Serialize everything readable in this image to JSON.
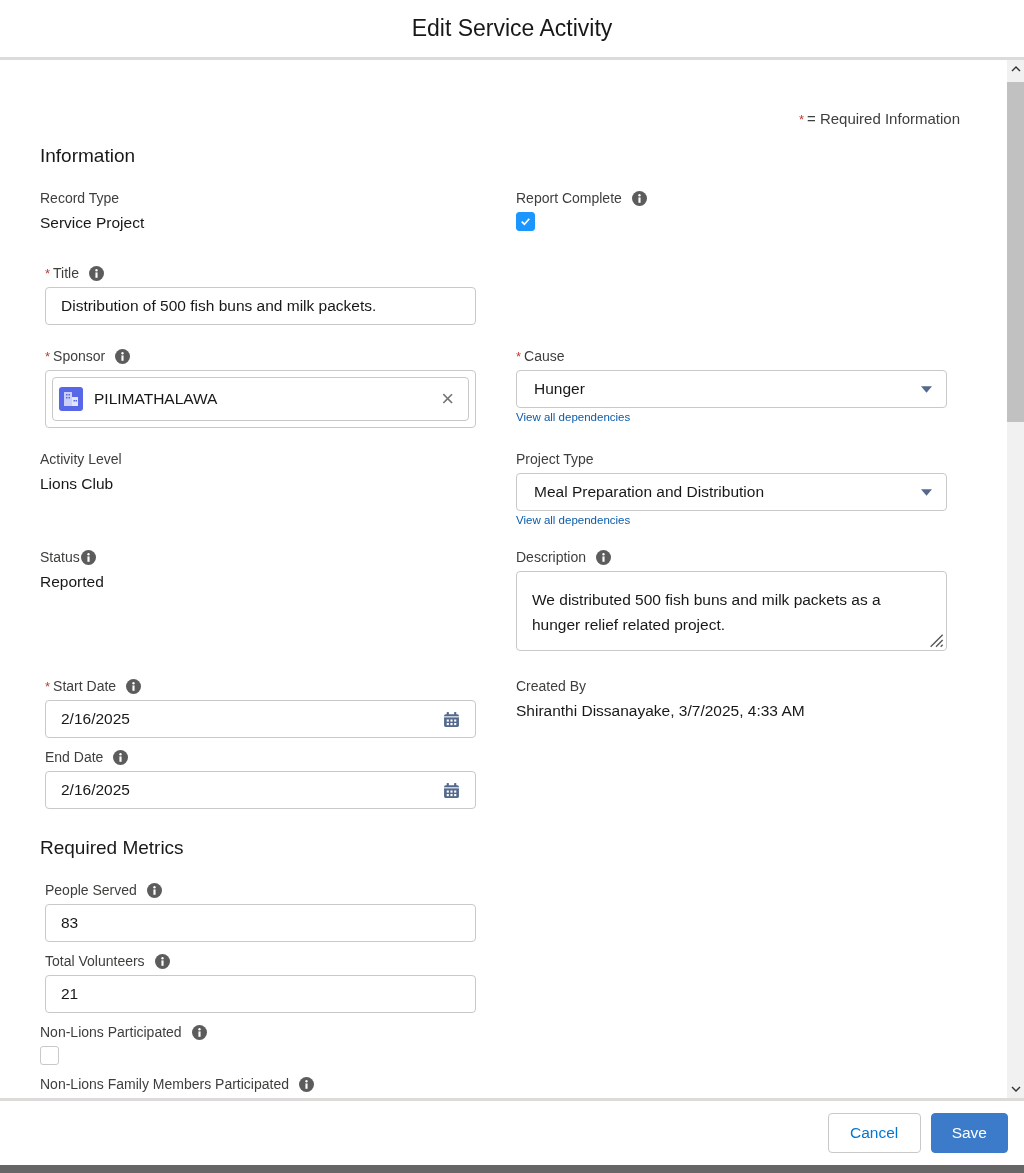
{
  "modal": {
    "title": "Edit Service Activity"
  },
  "required_legend": {
    "mark": "*",
    "text": "= Required Information"
  },
  "sections": [
    {
      "title": "Information",
      "rows": [
        {
          "left": [
            {
              "kind": "readonly",
              "label": "Record Type",
              "required": false,
              "info": false,
              "value": "Service Project"
            }
          ],
          "right": [
            {
              "kind": "checkbox",
              "label": "Report Complete",
              "required": false,
              "info": true,
              "checked": true
            }
          ]
        },
        {
          "left": [
            {
              "kind": "text",
              "label": "Title",
              "required": true,
              "info": true,
              "value": "Distribution of 500 fish buns and milk packets."
            }
          ],
          "right": []
        },
        {
          "left": [
            {
              "kind": "lookup",
              "label": "Sponsor",
              "required": true,
              "info": true,
              "value": "PILIMATHALAWA",
              "clear": "×"
            }
          ],
          "right": [
            {
              "kind": "picklist",
              "label": "Cause",
              "required": true,
              "info": false,
              "value": "Hunger",
              "link": "View all dependencies"
            }
          ]
        },
        {
          "left": [
            {
              "kind": "readonly",
              "label": "Activity Level",
              "required": false,
              "info": false,
              "value": "Lions Club"
            }
          ],
          "right": [
            {
              "kind": "picklist",
              "label": "Project Type",
              "required": false,
              "info": false,
              "value": "Meal Preparation and Distribution",
              "link": "View all dependencies"
            }
          ]
        },
        {
          "left": [
            {
              "kind": "readonly",
              "label": "Status",
              "required": false,
              "info": true,
              "value": "Reported"
            }
          ],
          "right": [
            {
              "kind": "textarea",
              "label": "Description",
              "required": false,
              "info": true,
              "value": "We distributed 500 fish buns and milk packets as a hunger relief related project."
            }
          ]
        },
        {
          "left": [
            {
              "kind": "date",
              "label": "Start Date",
              "required": true,
              "info": true,
              "value": "2/16/2025"
            },
            {
              "kind": "date",
              "label": "End Date",
              "required": false,
              "info": true,
              "value": "2/16/2025"
            }
          ],
          "right": [
            {
              "kind": "readonly",
              "label": "Created By",
              "required": false,
              "info": false,
              "value": "Shiranthi Dissanayake, 3/7/2025, 4:33 AM"
            }
          ]
        }
      ]
    },
    {
      "title": "Required Metrics",
      "rows": [
        {
          "left": [
            {
              "kind": "text",
              "label": "People Served",
              "required": false,
              "info": true,
              "value": "83"
            },
            {
              "kind": "text",
              "label": "Total Volunteers",
              "required": false,
              "info": true,
              "value": "21"
            },
            {
              "kind": "checkbox",
              "label": "Non-Lions Participated",
              "required": false,
              "info": true,
              "checked": false
            },
            {
              "kind": "checkbox",
              "label": "Non-Lions Family Members Participated",
              "required": false,
              "info": true
            }
          ],
          "right": []
        }
      ]
    }
  ],
  "footer": {
    "buttons": [
      {
        "label": "Cancel",
        "kind": "neutral"
      },
      {
        "label": "Save",
        "kind": "brand"
      }
    ]
  }
}
